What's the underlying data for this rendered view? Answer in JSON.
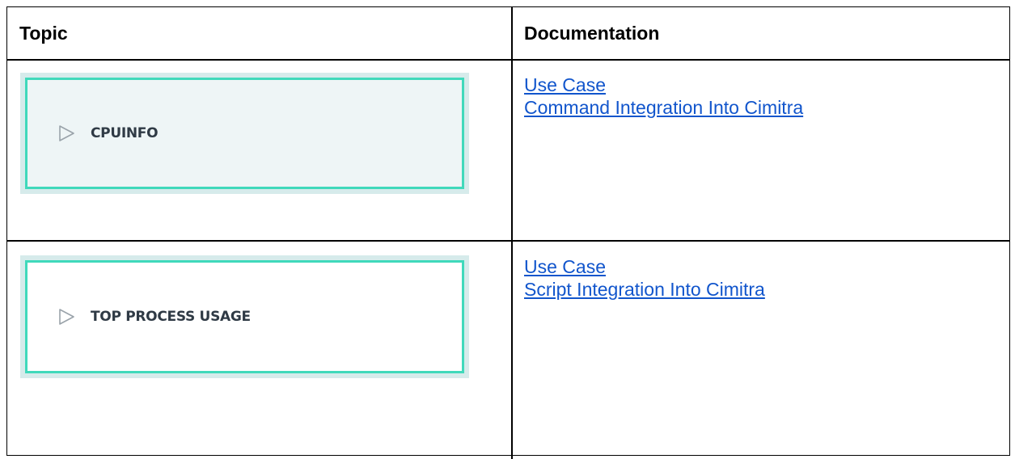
{
  "table": {
    "headers": {
      "topic": "Topic",
      "documentation": "Documentation"
    },
    "rows": [
      {
        "command": "CPUINFO",
        "icon": "play-icon",
        "links": [
          "Use Case",
          "Command Integration Into Cimitra"
        ]
      },
      {
        "command": "TOP PROCESS USAGE",
        "icon": "play-icon",
        "links": [
          "Use Case",
          "Script Integration Into Cimitra"
        ]
      }
    ]
  },
  "colors": {
    "card_border": "#40d9bb",
    "card_outer": "#d6ebeb",
    "card_fill_row1": "#eef5f6",
    "card_fill_row2": "#ffffff",
    "link": "#1155cc"
  }
}
